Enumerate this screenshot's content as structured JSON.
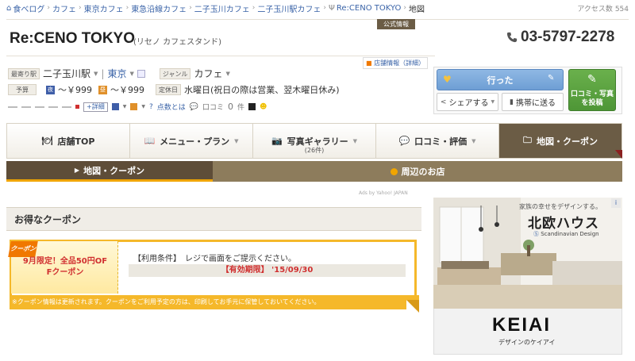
{
  "breadcrumb": {
    "items": [
      "食べログ",
      "カフェ",
      "東京カフェ",
      "東急沿線カフェ",
      "二子玉川カフェ",
      "二子玉川駅カフェ",
      "Re:CENO TOKYO"
    ],
    "current": "地図",
    "access_label": "アクセス数",
    "access_count": "554"
  },
  "shop": {
    "official_tag": "公式情報",
    "name": "Re:CENO TOKYO",
    "kana": "(リセノ カフェスタンド)",
    "phone": "03-5797-2278",
    "shopinfo_detail": "店舗情報（詳細）"
  },
  "info": {
    "station_label": "最寄り駅",
    "station": "二子玉川駅",
    "area": "東京",
    "genre_label": "ジャンル",
    "genre": "カフェ",
    "budget_label": "予算",
    "dinner_icon": "夜",
    "dinner_price": "～￥999",
    "lunch_icon": "昼",
    "lunch_price": "～￥999",
    "holiday_label": "定休日",
    "holiday": "水曜日(祝日の際は営業、翌木曜日休み)",
    "detail_btn": "+詳細",
    "points_label": "点数とは",
    "review_label": "口コミ",
    "review_count": "0",
    "review_unit": "件"
  },
  "actions": {
    "went": "行った",
    "share": "シェアする",
    "mobile": "携帯に送る",
    "post": "口コミ・写真を投稿"
  },
  "tabs": [
    {
      "label": "店舗TOP",
      "icon": "fork-knife-icon"
    },
    {
      "label": "メニュー・プラン",
      "icon": "book-icon"
    },
    {
      "label": "写真ギャラリー",
      "icon": "camera-icon",
      "sub": "(26件)"
    },
    {
      "label": "口コミ・評価",
      "icon": "speech-bubble-icon"
    },
    {
      "label": "地図・クーポン",
      "icon": "folder-icon"
    }
  ],
  "subnav": {
    "map_coupon": "地図・クーポン",
    "nearby": "周辺のお店"
  },
  "yahoo_credit": "Ads by Yahoo! JAPAN",
  "coupon": {
    "heading": "お得なクーポン",
    "ribbon": "クーポン",
    "title_line1": "9月限定！全品50円OF",
    "title_line2": "Fクーポン",
    "condition": "【利用条件】　レジで画面をご提示ください。",
    "expiry": "【有効期限】 '15/09/30",
    "footer": "※クーポン情報は更新されます。クーポンをご利用予定の方は、印刷してお手元に保管しておいてください。"
  },
  "ad": {
    "tagline": "家族の幸せをデザインする。",
    "brand": "北欧ハウス",
    "design": "Scandinavian Design",
    "company": "KEIAI",
    "company_sub": "デザインのケイアイ"
  },
  "colors": {
    "link": "#3b64a8",
    "tab_active": "#6b5c45",
    "coupon_border": "#f5b82a",
    "accent_red": "#d03030"
  }
}
